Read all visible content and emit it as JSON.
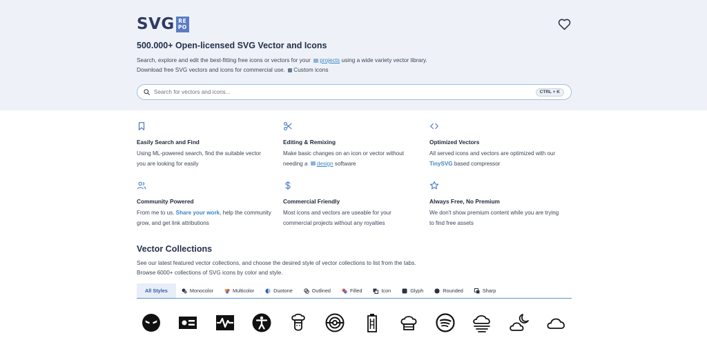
{
  "header": {
    "logo_text": "SVG",
    "logo_badge_top": "RE",
    "logo_badge_bottom": "PO",
    "favorites_icon": "heart-icon"
  },
  "hero": {
    "title": "500.000+ Open-licensed SVG Vector and Icons",
    "line1_prefix": "Search, explore and edit the best-fitting free icons or vectors for your",
    "line1_link": "projects",
    "line1_suffix": "using a wide variety vector library.",
    "line2_prefix": "Download free SVG vectors and icons for commercial use.",
    "line2_link": "Custom icons"
  },
  "search": {
    "placeholder": "Search for vectors and icons...",
    "shortcut": "CTRL + K",
    "icon": "search-icon"
  },
  "features": [
    {
      "icon": "bookmark-icon",
      "title": "Easily Search and Find",
      "desc1": "Using ML-powered search, find the suitable vector",
      "desc2": "you are looking for easily"
    },
    {
      "icon": "scissors-icon",
      "title": "Editing & Remixing",
      "desc1": "Make basic changes on an icon or vector without",
      "desc2_prefix": "needing a",
      "desc2_link": "design",
      "desc2_suffix": "software"
    },
    {
      "icon": "code-icon",
      "title": "Optimized Vectors",
      "desc1": "All served icons and vectors are optimized with our",
      "desc2_link": "TinySVG",
      "desc2_suffix": "based compressor"
    },
    {
      "icon": "users-icon",
      "title": "Community Powered",
      "desc1_prefix": "From me to us.",
      "desc1_link": "Share your work",
      "desc1_suffix": ", help the community",
      "desc2": "grow, and get link attributions"
    },
    {
      "icon": "dollar-icon",
      "title": "Commercial Friendly",
      "desc1": "Most icons and vectors are useable for your",
      "desc2": "commercial projects without any royalties"
    },
    {
      "icon": "star-icon",
      "title": "Always Free, No Premium",
      "desc1": "We don't show premium content while you are trying",
      "desc2": "to find free assets"
    }
  ],
  "collections": {
    "title": "Vector Collections",
    "line1": "See our latest featured vector collections, and choose the desired style of vector collections to list from the tabs.",
    "line2": "Browse 6000+ collections of SVG icons by color and style.",
    "tabs": [
      {
        "label": "All Styles",
        "active": true
      },
      {
        "label": "Monocolor"
      },
      {
        "label": "Multicolor"
      },
      {
        "label": "Duotone"
      },
      {
        "label": "Outlined"
      },
      {
        "label": "Filled"
      },
      {
        "label": "Icon"
      },
      {
        "label": "Glyph"
      },
      {
        "label": "Rounded"
      },
      {
        "label": "Sharp"
      }
    ],
    "preview_icons": [
      "alien-icon",
      "id-card-icon",
      "pulse-icon",
      "accessibility-icon",
      "chef-icon",
      "pokeball-icon",
      "battery-icon",
      "chef-hat-icon",
      "spotify-icon",
      "fog-icon",
      "moon-cloud-icon",
      "cloud-icon"
    ]
  },
  "colors": {
    "hero_bg": "#eef2f8",
    "accent": "#3b86c4",
    "feature_icon": "#4a7bc8",
    "logo": "#2f3b63"
  }
}
